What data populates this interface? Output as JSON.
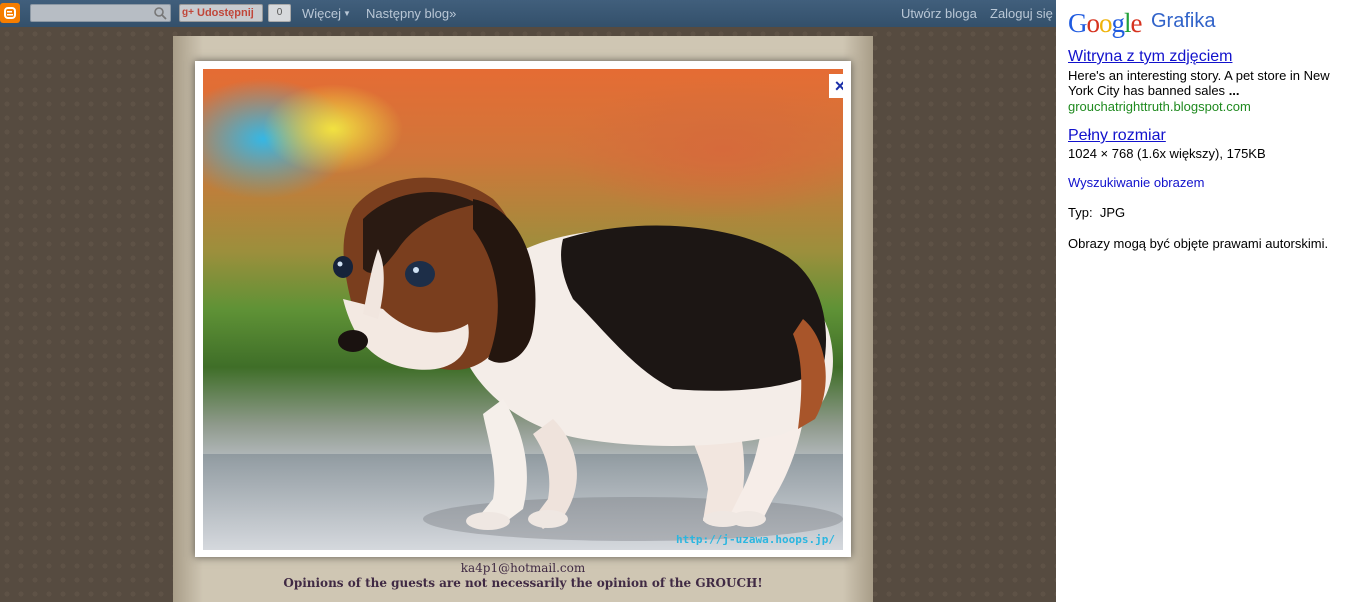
{
  "navbar": {
    "share_label": "Udostępnij",
    "share_count": "0",
    "more_label": "Więcej",
    "next_blog_label": "Następny blog»",
    "create_blog_label": "Utwórz bloga",
    "login_label": "Zaloguj się"
  },
  "blog": {
    "email": "ka4p1@hotmail.com",
    "disclaimer": "Opinions of the guests are not necessarily the opinion of the GROUCH!"
  },
  "lightbox": {
    "close_symbol": "×",
    "watermark": "http://j-uzawa.hoops.jp/"
  },
  "panel": {
    "logo_text": "Google",
    "section_title": "Grafika",
    "site_link_label": "Witryna z tym zdjęciem",
    "site_description": "Here's an interesting story. A pet store in New York City has banned sales",
    "site_description_ellipsis": "...",
    "site_url": "grouchatrighttruth.blogspot.com",
    "full_size_label": "Pełny rozmiar",
    "full_size_info": "1024 × 768 (1.6x większy), 175KB",
    "search_by_image_label": "Wyszukiwanie obrazem",
    "type_label": "Typ:",
    "type_value": "JPG",
    "copyright_note": "Obrazy mogą być objęte prawami autorskimi."
  },
  "colors": {
    "navbar": "#3a5670",
    "link": "#1212cc",
    "url_green": "#1f8a1f",
    "blogger_orange": "#f57d00"
  }
}
